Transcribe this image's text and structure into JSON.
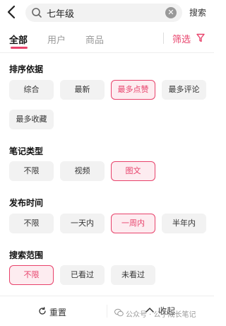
{
  "search": {
    "value": "七年级",
    "button": "搜索"
  },
  "tabs": [
    {
      "label": "全部",
      "active": true
    },
    {
      "label": "用户",
      "active": false
    },
    {
      "label": "商品",
      "active": false
    }
  ],
  "filter": {
    "label": "筛选"
  },
  "sections": [
    {
      "title": "排序依据",
      "options": [
        "综合",
        "最新",
        "最多点赞",
        "最多评论",
        "最多收藏"
      ],
      "selected": "最多点赞"
    },
    {
      "title": "笔记类型",
      "options": [
        "不限",
        "视频",
        "图文"
      ],
      "selected": "图文"
    },
    {
      "title": "发布时间",
      "options": [
        "不限",
        "一天内",
        "一周内",
        "半年内"
      ],
      "selected": "一周内"
    },
    {
      "title": "搜索范围",
      "options": [
        "不限",
        "已看过",
        "未看过"
      ],
      "selected": "不限"
    }
  ],
  "footer": {
    "reset": "重置",
    "collapse": "收起"
  },
  "watermark": {
    "text": "公众号 · 公子成长笔记"
  },
  "colors": {
    "accent": "#e8426b",
    "chip_bg": "#f2f2f2",
    "selected_bg": "#fdecf0"
  }
}
